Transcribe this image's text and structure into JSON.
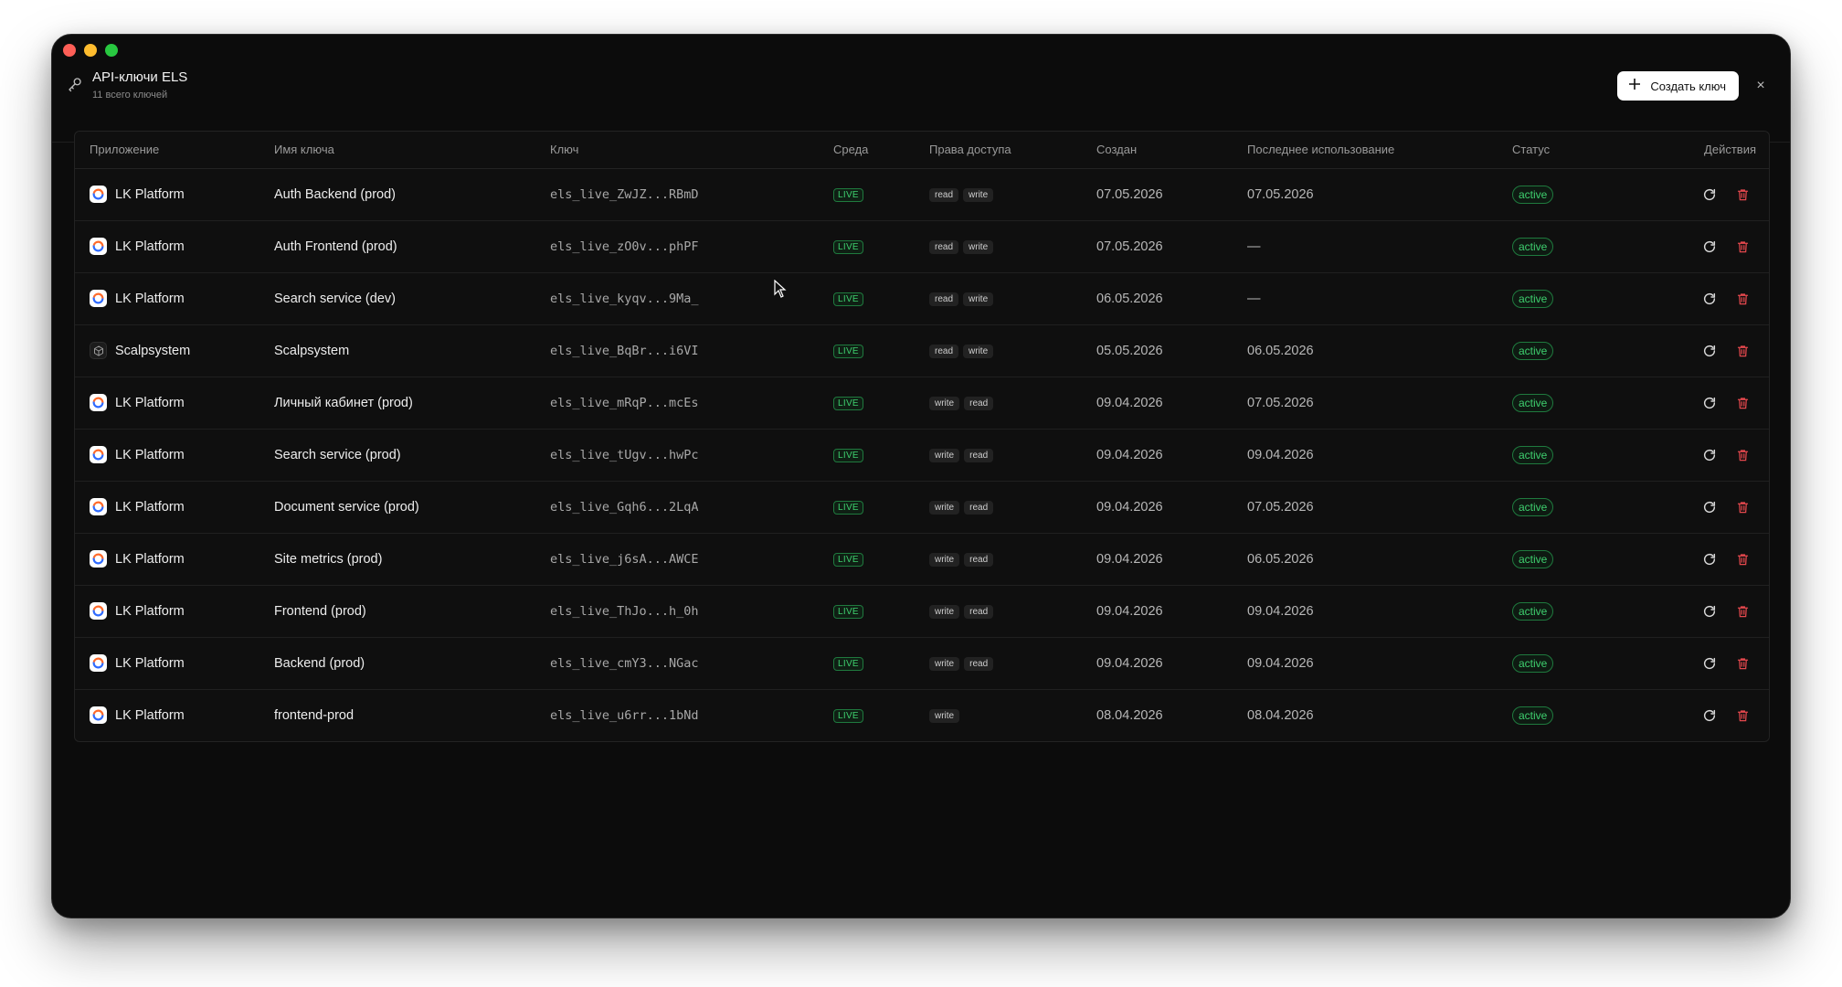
{
  "header": {
    "title": "API-ключи ELS",
    "subtitle": "11 всего ключей",
    "create_label": "Создать ключ",
    "close_glyph": "×"
  },
  "columns": {
    "app": "Приложение",
    "name": "Имя ключа",
    "key": "Ключ",
    "env": "Среда",
    "perms": "Права доступа",
    "created": "Создан",
    "last_used": "Последнее использование",
    "status": "Статус",
    "actions": "Действия"
  },
  "rows": [
    {
      "app": "LK Platform",
      "app_icon": "lk-platform-logo",
      "name": "Auth Backend (prod)",
      "key": "els_live_ZwJZ...RBmD",
      "env": "LIVE",
      "perms": [
        "read",
        "write"
      ],
      "created": "07.05.2026",
      "last_used": "07.05.2026",
      "status": "active"
    },
    {
      "app": "LK Platform",
      "app_icon": "lk-platform-logo",
      "name": "Auth Frontend (prod)",
      "key": "els_live_zO0v...phPF",
      "env": "LIVE",
      "perms": [
        "read",
        "write"
      ],
      "created": "07.05.2026",
      "last_used": "—",
      "status": "active"
    },
    {
      "app": "LK Platform",
      "app_icon": "lk-platform-logo",
      "name": "Search service (dev)",
      "key": "els_live_kyqv...9Ma_",
      "env": "LIVE",
      "perms": [
        "read",
        "write"
      ],
      "created": "06.05.2026",
      "last_used": "—",
      "status": "active"
    },
    {
      "app": "Scalpsystem",
      "app_icon": "scalpsystem-logo",
      "name": "Scalpsystem",
      "key": "els_live_BqBr...i6VI",
      "env": "LIVE",
      "perms": [
        "read",
        "write"
      ],
      "created": "05.05.2026",
      "last_used": "06.05.2026",
      "status": "active"
    },
    {
      "app": "LK Platform",
      "app_icon": "lk-platform-logo",
      "name": "Личный кабинет (prod)",
      "key": "els_live_mRqP...mcEs",
      "env": "LIVE",
      "perms": [
        "write",
        "read"
      ],
      "created": "09.04.2026",
      "last_used": "07.05.2026",
      "status": "active"
    },
    {
      "app": "LK Platform",
      "app_icon": "lk-platform-logo",
      "name": "Search service (prod)",
      "key": "els_live_tUgv...hwPc",
      "env": "LIVE",
      "perms": [
        "write",
        "read"
      ],
      "created": "09.04.2026",
      "last_used": "09.04.2026",
      "status": "active"
    },
    {
      "app": "LK Platform",
      "app_icon": "lk-platform-logo",
      "name": "Document service (prod)",
      "key": "els_live_Gqh6...2LqA",
      "env": "LIVE",
      "perms": [
        "write",
        "read"
      ],
      "created": "09.04.2026",
      "last_used": "07.05.2026",
      "status": "active"
    },
    {
      "app": "LK Platform",
      "app_icon": "lk-platform-logo",
      "name": "Site metrics (prod)",
      "key": "els_live_j6sA...AWCE",
      "env": "LIVE",
      "perms": [
        "write",
        "read"
      ],
      "created": "09.04.2026",
      "last_used": "06.05.2026",
      "status": "active"
    },
    {
      "app": "LK Platform",
      "app_icon": "lk-platform-logo",
      "name": "Frontend (prod)",
      "key": "els_live_ThJo...h_0h",
      "env": "LIVE",
      "perms": [
        "write",
        "read"
      ],
      "created": "09.04.2026",
      "last_used": "09.04.2026",
      "status": "active"
    },
    {
      "app": "LK Platform",
      "app_icon": "lk-platform-logo",
      "name": "Backend (prod)",
      "key": "els_live_cmY3...NGac",
      "env": "LIVE",
      "perms": [
        "write",
        "read"
      ],
      "created": "09.04.2026",
      "last_used": "09.04.2026",
      "status": "active"
    },
    {
      "app": "LK Platform",
      "app_icon": "lk-platform-logo",
      "name": "frontend-prod",
      "key": "els_live_u6rr...1bNd",
      "env": "LIVE",
      "perms": [
        "write"
      ],
      "created": "08.04.2026",
      "last_used": "08.04.2026",
      "status": "active"
    }
  ],
  "colors": {
    "live_green": "#3ecf6e",
    "delete_red": "#e5484d",
    "window_bg": "#0c0c0c"
  },
  "icons": {
    "header": "key-icon",
    "create": "plus-icon",
    "close": "close-icon",
    "rotate": "refresh-icon",
    "delete": "trash-icon"
  }
}
